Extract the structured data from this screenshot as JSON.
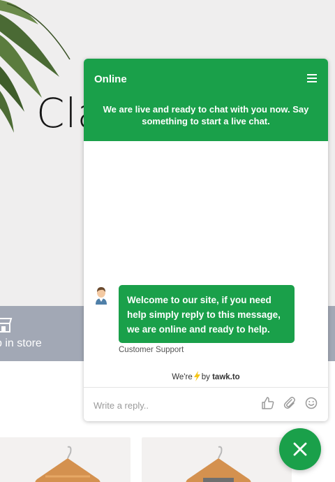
{
  "hero": {
    "title_partial": "Cla"
  },
  "feature_bar": {
    "store_label": "p in store",
    "store_icon": "store-icon"
  },
  "chat": {
    "status": "Online",
    "banner": "We are live and ready to chat with you now. Say something to start a live chat.",
    "message": {
      "text": "Welcome to our site, if you need help simply reply to this message, we are online and ready to help.",
      "sender": "Customer Support"
    },
    "powered_prefix": "We're",
    "powered_by": "by",
    "powered_brand": "tawk.to",
    "reply_placeholder": "Write a reply..",
    "icons": [
      "menu-icon",
      "thumbs-up-icon",
      "paperclip-icon",
      "smiley-icon",
      "close-icon"
    ]
  },
  "colors": {
    "brand_green": "#1aa04a",
    "feature_bar": "#a2a8b5",
    "hero_bg": "#efeeee"
  }
}
